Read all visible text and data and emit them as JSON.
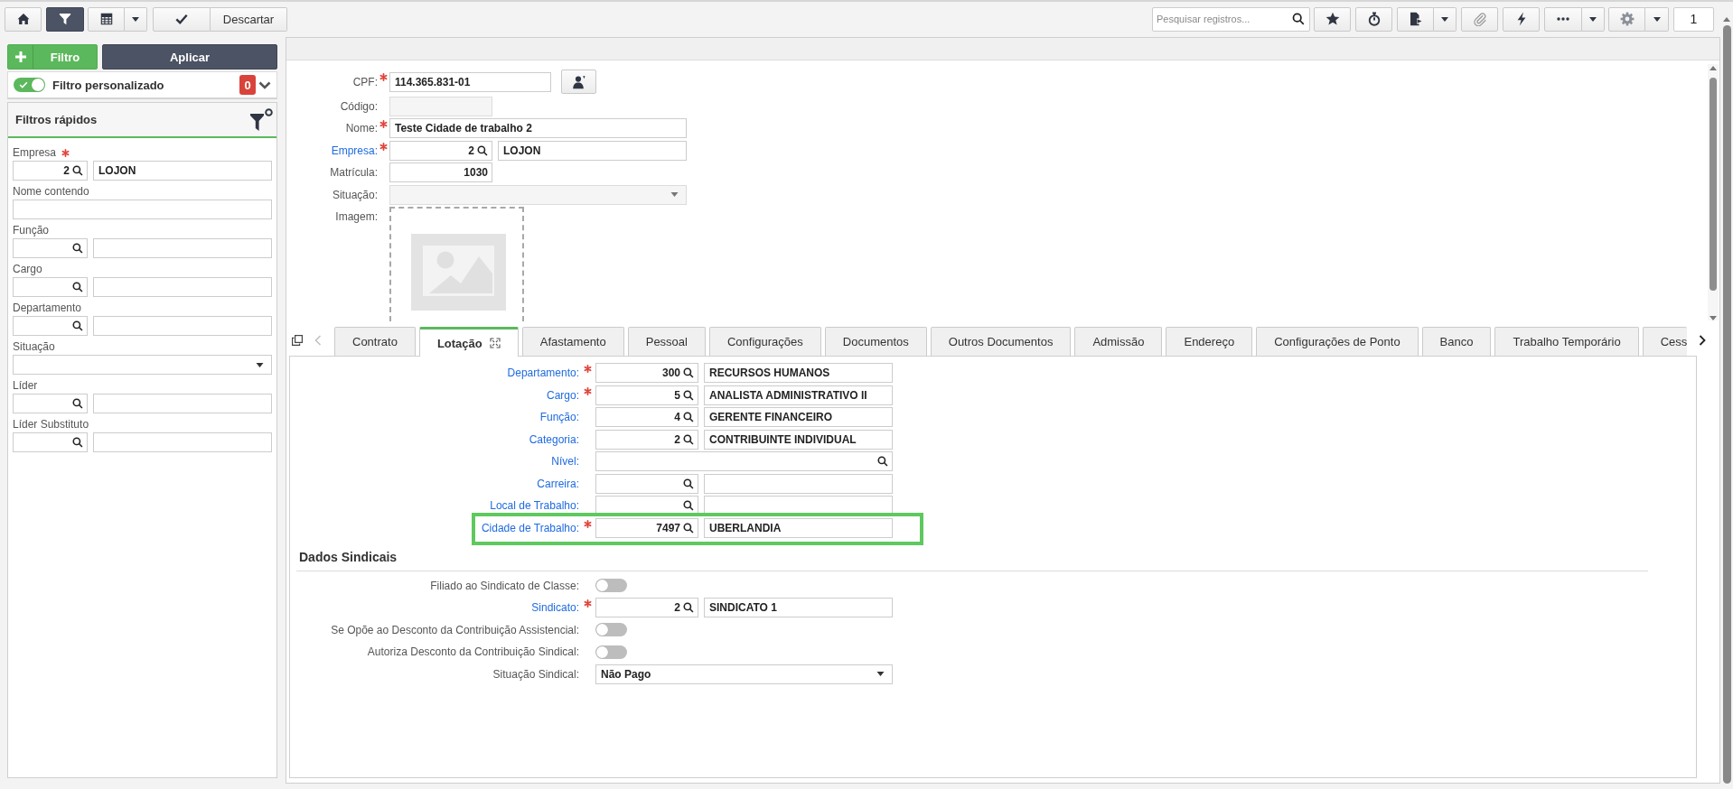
{
  "toolbar": {
    "home_button": {
      "selected": false
    },
    "filter_button": {
      "selected": true
    },
    "list_button": {
      "selected": false
    },
    "discard_button": {
      "label": "Descartar"
    },
    "search": {
      "placeholder": "Pesquisar registros..."
    },
    "page_field": {
      "value": "1"
    }
  },
  "filter_panel": {
    "add_button": {
      "label": "Filtro"
    },
    "apply_button": {
      "label": "Aplicar"
    },
    "custom_filter": {
      "label": "Filtro personalizado",
      "on": true,
      "count": "0"
    },
    "quick_filters": {
      "title": "Filtros rápidos",
      "fields": [
        {
          "kind": "lookup",
          "label": "Empresa",
          "required": true,
          "selection": {
            "code": "2",
            "name": "LOJON"
          }
        },
        {
          "kind": "text",
          "label": "Nome contendo",
          "required": false
        },
        {
          "kind": "lookup",
          "label": "Função",
          "required": false
        },
        {
          "kind": "lookup",
          "label": "Cargo",
          "required": false
        },
        {
          "kind": "lookup",
          "label": "Departamento",
          "required": false
        },
        {
          "kind": "select",
          "label": "Situação",
          "required": false
        },
        {
          "kind": "lookup",
          "label": "Líder",
          "required": false
        },
        {
          "kind": "lookup",
          "label": "Líder Substituto",
          "required": false
        }
      ]
    }
  },
  "record": {
    "fields": [
      {
        "kind": "text_button",
        "label": "CPF:",
        "required": true,
        "link": false,
        "disabled": false,
        "value": "114.365.831-01"
      },
      {
        "kind": "number",
        "label": "Código:",
        "required": false,
        "link": false,
        "disabled": true
      },
      {
        "kind": "text",
        "label": "Nome:",
        "required": true,
        "link": false,
        "disabled": false,
        "value": "Teste Cidade de trabalho 2"
      },
      {
        "kind": "lookup",
        "label": "Empresa:",
        "required": true,
        "link": true,
        "disabled": false,
        "code": "2",
        "value": "LOJON"
      },
      {
        "kind": "number",
        "label": "Matrícula:",
        "required": false,
        "link": false,
        "disabled": false,
        "value": "1030"
      },
      {
        "kind": "select",
        "label": "Situação:",
        "required": false,
        "link": false,
        "disabled": true
      },
      {
        "kind": "image",
        "label": "Imagem:",
        "required": false,
        "link": false
      }
    ]
  },
  "tabs": [
    {
      "label": "Contrato",
      "selected": false
    },
    {
      "label": "Lotação",
      "selected": true
    },
    {
      "label": "Afastamento",
      "selected": false
    },
    {
      "label": "Pessoal",
      "selected": false
    },
    {
      "label": "Configurações",
      "selected": false
    },
    {
      "label": "Documentos",
      "selected": false
    },
    {
      "label": "Outros Documentos",
      "selected": false
    },
    {
      "label": "Admissão",
      "selected": false
    },
    {
      "label": "Endereço",
      "selected": false
    },
    {
      "label": "Configurações de Ponto",
      "selected": false
    },
    {
      "label": "Banco",
      "selected": false
    },
    {
      "label": "Trabalho Temporário",
      "selected": false
    },
    {
      "label": "Cess",
      "selected": false
    }
  ],
  "lotacao": {
    "fields": [
      {
        "kind": "lookup",
        "label": "Departamento:",
        "required": true,
        "link": true,
        "highlighted": false,
        "code": "300",
        "value": "RECURSOS HUMANOS"
      },
      {
        "kind": "lookup",
        "label": "Cargo:",
        "required": true,
        "link": true,
        "highlighted": false,
        "code": "5",
        "value": "ANALISTA ADMINISTRATIVO II"
      },
      {
        "kind": "lookup",
        "label": "Função:",
        "required": false,
        "link": true,
        "highlighted": false,
        "code": "4",
        "value": "GERENTE FINANCEIRO"
      },
      {
        "kind": "lookup",
        "label": "Categoria:",
        "required": false,
        "link": true,
        "highlighted": false,
        "code": "2",
        "value": "CONTRIBUINTE INDIVIDUAL"
      },
      {
        "kind": "lookup_single",
        "label": "Nível:",
        "required": false,
        "link": true,
        "highlighted": false
      },
      {
        "kind": "lookup",
        "label": "Carreira:",
        "required": false,
        "link": true,
        "highlighted": false
      },
      {
        "kind": "lookup",
        "label": "Local de Trabalho:",
        "required": false,
        "link": true,
        "highlighted": false
      },
      {
        "kind": "lookup",
        "label": "Cidade de Trabalho:",
        "required": true,
        "link": true,
        "highlighted": true,
        "code": "7497",
        "value": "UBERLANDIA"
      }
    ]
  },
  "union_data": {
    "title": "Dados Sindicais",
    "fields": [
      {
        "kind": "toggle",
        "label": "Filiado ao Sindicato de Classe:",
        "required": false,
        "link": false,
        "on": false
      },
      {
        "kind": "lookup",
        "label": "Sindicato:",
        "required": true,
        "link": true,
        "code": "2",
        "value": "SINDICATO 1"
      },
      {
        "kind": "toggle",
        "label": "Se Opõe ao Desconto da Contribuição Assistencial:",
        "required": false,
        "link": false,
        "on": false
      },
      {
        "kind": "toggle",
        "label": "Autoriza Desconto da Contribuição Sindical:",
        "required": false,
        "link": false,
        "on": false
      },
      {
        "kind": "select",
        "label": "Situação Sindical:",
        "required": false,
        "link": false,
        "value": "Não Pago"
      }
    ]
  }
}
